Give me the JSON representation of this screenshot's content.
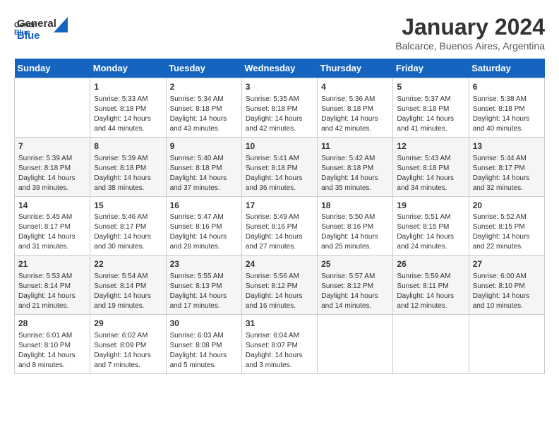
{
  "logo": {
    "line1": "General",
    "line2": "Blue"
  },
  "title": "January 2024",
  "subtitle": "Balcarce, Buenos Aires, Argentina",
  "days_of_week": [
    "Sunday",
    "Monday",
    "Tuesday",
    "Wednesday",
    "Thursday",
    "Friday",
    "Saturday"
  ],
  "weeks": [
    [
      {
        "day": "",
        "info": ""
      },
      {
        "day": "1",
        "info": "Sunrise: 5:33 AM\nSunset: 8:18 PM\nDaylight: 14 hours\nand 44 minutes."
      },
      {
        "day": "2",
        "info": "Sunrise: 5:34 AM\nSunset: 8:18 PM\nDaylight: 14 hours\nand 43 minutes."
      },
      {
        "day": "3",
        "info": "Sunrise: 5:35 AM\nSunset: 8:18 PM\nDaylight: 14 hours\nand 42 minutes."
      },
      {
        "day": "4",
        "info": "Sunrise: 5:36 AM\nSunset: 8:18 PM\nDaylight: 14 hours\nand 42 minutes."
      },
      {
        "day": "5",
        "info": "Sunrise: 5:37 AM\nSunset: 8:18 PM\nDaylight: 14 hours\nand 41 minutes."
      },
      {
        "day": "6",
        "info": "Sunrise: 5:38 AM\nSunset: 8:18 PM\nDaylight: 14 hours\nand 40 minutes."
      }
    ],
    [
      {
        "day": "7",
        "info": "Sunrise: 5:39 AM\nSunset: 8:18 PM\nDaylight: 14 hours\nand 39 minutes."
      },
      {
        "day": "8",
        "info": "Sunrise: 5:39 AM\nSunset: 8:18 PM\nDaylight: 14 hours\nand 38 minutes."
      },
      {
        "day": "9",
        "info": "Sunrise: 5:40 AM\nSunset: 8:18 PM\nDaylight: 14 hours\nand 37 minutes."
      },
      {
        "day": "10",
        "info": "Sunrise: 5:41 AM\nSunset: 8:18 PM\nDaylight: 14 hours\nand 36 minutes."
      },
      {
        "day": "11",
        "info": "Sunrise: 5:42 AM\nSunset: 8:18 PM\nDaylight: 14 hours\nand 35 minutes."
      },
      {
        "day": "12",
        "info": "Sunrise: 5:43 AM\nSunset: 8:18 PM\nDaylight: 14 hours\nand 34 minutes."
      },
      {
        "day": "13",
        "info": "Sunrise: 5:44 AM\nSunset: 8:17 PM\nDaylight: 14 hours\nand 32 minutes."
      }
    ],
    [
      {
        "day": "14",
        "info": "Sunrise: 5:45 AM\nSunset: 8:17 PM\nDaylight: 14 hours\nand 31 minutes."
      },
      {
        "day": "15",
        "info": "Sunrise: 5:46 AM\nSunset: 8:17 PM\nDaylight: 14 hours\nand 30 minutes."
      },
      {
        "day": "16",
        "info": "Sunrise: 5:47 AM\nSunset: 8:16 PM\nDaylight: 14 hours\nand 28 minutes."
      },
      {
        "day": "17",
        "info": "Sunrise: 5:49 AM\nSunset: 8:16 PM\nDaylight: 14 hours\nand 27 minutes."
      },
      {
        "day": "18",
        "info": "Sunrise: 5:50 AM\nSunset: 8:16 PM\nDaylight: 14 hours\nand 25 minutes."
      },
      {
        "day": "19",
        "info": "Sunrise: 5:51 AM\nSunset: 8:15 PM\nDaylight: 14 hours\nand 24 minutes."
      },
      {
        "day": "20",
        "info": "Sunrise: 5:52 AM\nSunset: 8:15 PM\nDaylight: 14 hours\nand 22 minutes."
      }
    ],
    [
      {
        "day": "21",
        "info": "Sunrise: 5:53 AM\nSunset: 8:14 PM\nDaylight: 14 hours\nand 21 minutes."
      },
      {
        "day": "22",
        "info": "Sunrise: 5:54 AM\nSunset: 8:14 PM\nDaylight: 14 hours\nand 19 minutes."
      },
      {
        "day": "23",
        "info": "Sunrise: 5:55 AM\nSunset: 8:13 PM\nDaylight: 14 hours\nand 17 minutes."
      },
      {
        "day": "24",
        "info": "Sunrise: 5:56 AM\nSunset: 8:12 PM\nDaylight: 14 hours\nand 16 minutes."
      },
      {
        "day": "25",
        "info": "Sunrise: 5:57 AM\nSunset: 8:12 PM\nDaylight: 14 hours\nand 14 minutes."
      },
      {
        "day": "26",
        "info": "Sunrise: 5:59 AM\nSunset: 8:11 PM\nDaylight: 14 hours\nand 12 minutes."
      },
      {
        "day": "27",
        "info": "Sunrise: 6:00 AM\nSunset: 8:10 PM\nDaylight: 14 hours\nand 10 minutes."
      }
    ],
    [
      {
        "day": "28",
        "info": "Sunrise: 6:01 AM\nSunset: 8:10 PM\nDaylight: 14 hours\nand 8 minutes."
      },
      {
        "day": "29",
        "info": "Sunrise: 6:02 AM\nSunset: 8:09 PM\nDaylight: 14 hours\nand 7 minutes."
      },
      {
        "day": "30",
        "info": "Sunrise: 6:03 AM\nSunset: 8:08 PM\nDaylight: 14 hours\nand 5 minutes."
      },
      {
        "day": "31",
        "info": "Sunrise: 6:04 AM\nSunset: 8:07 PM\nDaylight: 14 hours\nand 3 minutes."
      },
      {
        "day": "",
        "info": ""
      },
      {
        "day": "",
        "info": ""
      },
      {
        "day": "",
        "info": ""
      }
    ]
  ]
}
